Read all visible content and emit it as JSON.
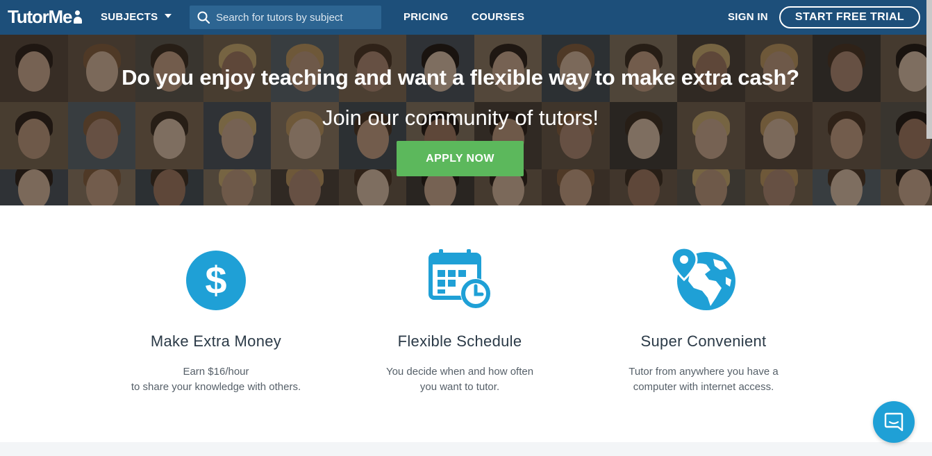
{
  "nav": {
    "logo": "TutorMe",
    "subjects": "SUBJECTS",
    "search_placeholder": "Search for tutors by subject",
    "pricing": "PRICING",
    "courses": "COURSES",
    "sign_in": "SIGN IN",
    "start_trial": "START FREE TRIAL"
  },
  "hero": {
    "title": "Do you enjoy teaching and want a flexible way to make extra cash?",
    "subtitle": "Join our community of tutors!",
    "cta": "APPLY NOW"
  },
  "features": [
    {
      "icon": "dollar-icon",
      "title": "Make Extra Money",
      "line1": "Earn $16/hour",
      "line2": "to share your knowledge with others."
    },
    {
      "icon": "calendar-clock-icon",
      "title": "Flexible Schedule",
      "line1": "You decide when and how often",
      "line2": "you want to tutor."
    },
    {
      "icon": "globe-pin-icon",
      "title": "Super Convenient",
      "line1": "Tutor from anywhere you have a",
      "line2": "computer with internet access."
    }
  ],
  "colors": {
    "navbar": "#1d4f7a",
    "accent_blue": "#1fa0d6",
    "cta_green": "#5cb85c"
  },
  "chat_icon": "chat-bubble-icon"
}
